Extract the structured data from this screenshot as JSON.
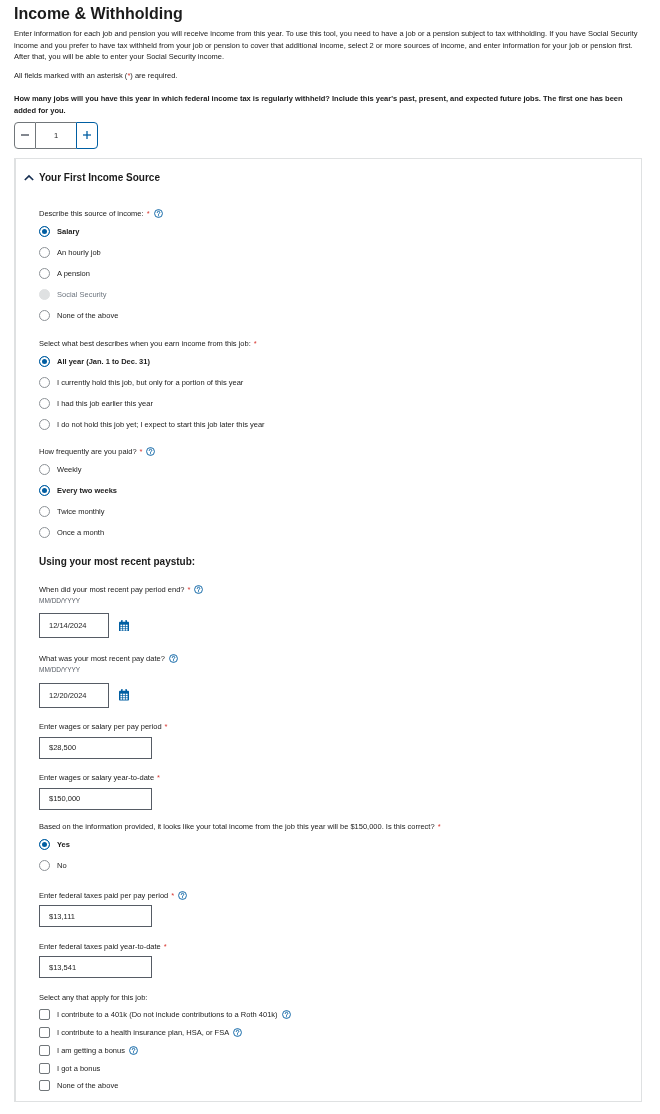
{
  "page": {
    "title": "Income & Withholding",
    "intro": "Enter information for each job and pension you will receive income from this year. To use this tool, you need to have a job or a pension subject to tax withholding. If you have Social Security income and you prefer to have tax withheld from your job or pension to cover that additional income, select 2 or more sources of income, and enter information for your job or pension first. After that, you will be able to enter your Social Security income.",
    "required_note": {
      "before": "All fields marked with an asterisk (",
      "mark": "*",
      "after": ") are required."
    }
  },
  "jobs": {
    "question": "How many jobs will you have this year in which federal income tax is regularly withheld? Include this year's past, present, and expected future jobs. The first one has been added for you.",
    "count": "1"
  },
  "income_source": {
    "title": "Your First Income Source",
    "expanded": true,
    "fields": [
      {
        "kind": "radio_group",
        "label": "Describe this source of income:",
        "required_mark": "*",
        "help": true,
        "options": [
          {
            "label": "Salary",
            "selected": true,
            "disabled": false
          },
          {
            "label": "An hourly job",
            "selected": false,
            "disabled": false
          },
          {
            "label": "A pension",
            "selected": false,
            "disabled": false
          },
          {
            "label": "Social Security",
            "selected": false,
            "disabled": true
          },
          {
            "label": "None of the above",
            "selected": false,
            "disabled": false
          }
        ]
      },
      {
        "kind": "radio_group",
        "label": "Select what best describes when you earn income from this job:",
        "required_mark": "*",
        "options": [
          {
            "label": "All year (Jan. 1 to Dec. 31)",
            "selected": true
          },
          {
            "label": "I currently hold this job, but only for a portion of this year",
            "selected": false
          },
          {
            "label": "I had this job earlier this year",
            "selected": false
          },
          {
            "label": "I do not hold this job yet; I expect to start this job later this year",
            "selected": false
          }
        ]
      },
      {
        "kind": "radio_group",
        "label": "How frequently are you paid?",
        "required_mark": "*",
        "help": true,
        "options": [
          {
            "label": "Weekly",
            "selected": false
          },
          {
            "label": "Every two weeks",
            "selected": true
          },
          {
            "label": "Twice monthly",
            "selected": false
          },
          {
            "label": "Once a month",
            "selected": false
          }
        ]
      },
      {
        "kind": "heading",
        "label": "Using your most recent paystub:"
      },
      {
        "kind": "date",
        "label": "When did your most recent pay period end?",
        "required_mark": "*",
        "help": true,
        "hint": "MM/DD/YYYY",
        "value": "12/14/2024"
      },
      {
        "kind": "date",
        "label": "What was your most recent pay date?",
        "help": true,
        "hint": "MM/DD/YYYY",
        "value": "12/20/2024"
      },
      {
        "kind": "text",
        "label": "Enter wages or salary per pay period",
        "required_mark": "*",
        "value": "$28,500"
      },
      {
        "kind": "text",
        "label": "Enter wages or salary year-to-date",
        "required_mark": "*",
        "value": "$150,000"
      },
      {
        "kind": "radio_group",
        "label": "Based on the information provided, it looks like your total income from the job this year will be $150,000. Is this correct?",
        "required_mark": "*",
        "options": [
          {
            "label": "Yes",
            "selected": true
          },
          {
            "label": "No",
            "selected": false
          }
        ]
      },
      {
        "kind": "text",
        "label": "Enter federal taxes paid per pay period",
        "required_mark": "*",
        "help": true,
        "value": "$13,111"
      },
      {
        "kind": "text",
        "label": "Enter federal taxes paid year-to-date",
        "required_mark": "*",
        "value": "$13,541"
      },
      {
        "kind": "checkbox_group",
        "label": "Select any that apply for this job:",
        "options": [
          {
            "label": "I contribute to a 401k (Do not include contributions to a Roth 401k)",
            "checked": false,
            "help": true
          },
          {
            "label": "I contribute to a health insurance plan, HSA, or FSA",
            "checked": false,
            "help": true
          },
          {
            "label": "I am getting a bonus",
            "checked": false,
            "help": true
          },
          {
            "label": "I got a bonus",
            "checked": false
          },
          {
            "label": "None of the above",
            "checked": false
          }
        ]
      }
    ]
  }
}
